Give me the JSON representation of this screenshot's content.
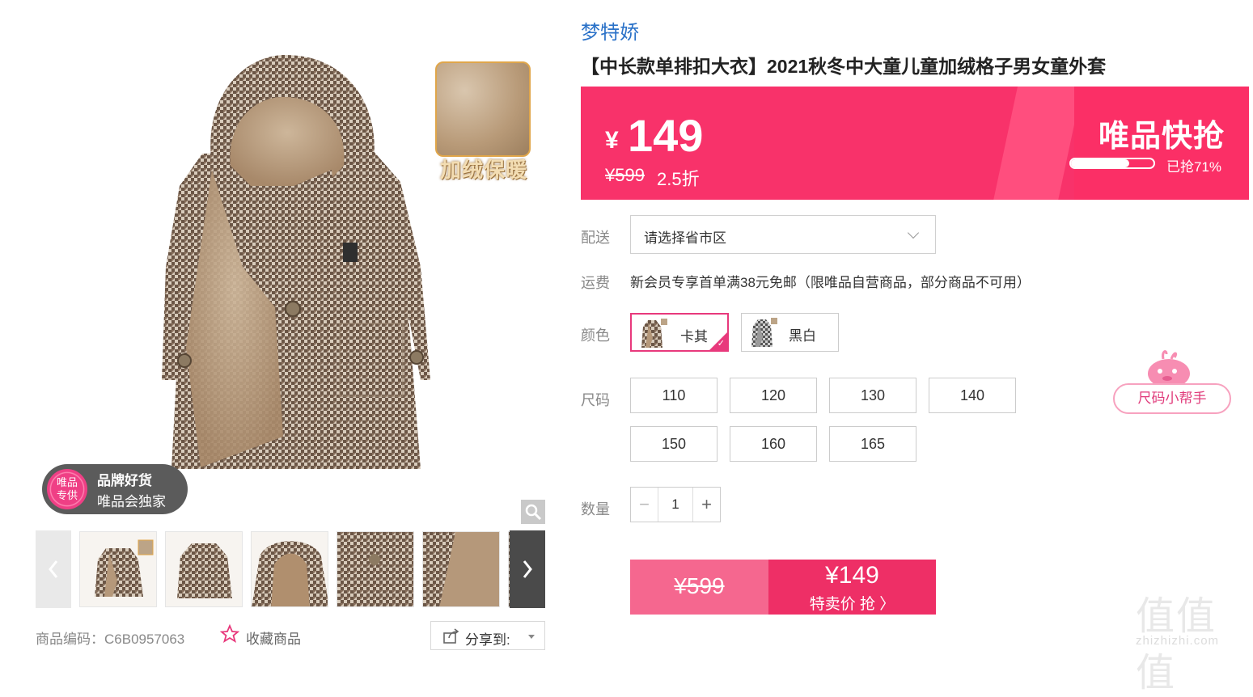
{
  "product": {
    "brand": "梦特娇",
    "title": "【中长款单排扣大衣】2021秋冬中大童儿童加绒格子男女童外套"
  },
  "gallery": {
    "inset_caption": "加绒保暖",
    "badge_seal": "唯品\n专供",
    "badge_title": "品牌好货",
    "badge_subtitle": "唯品会独家",
    "zoom_icon": "magnifier-icon",
    "prev_icon": "chevron-left-icon",
    "next_icon": "chevron-right-icon",
    "thumbnail_count": 6
  },
  "price": {
    "currency": "¥",
    "current": "149",
    "original": "¥599",
    "discount": "2.5折",
    "flash_title": "唯品快抢",
    "sold_text": "已抢71%",
    "sold_fraction": 0.71,
    "banner_color": "#f8326a"
  },
  "delivery": {
    "label": "配送",
    "placeholder": "请选择省市区"
  },
  "shipping": {
    "label": "运费",
    "text": "新会员专享首单满38元免邮（限唯品自营商品，部分商品不可用）"
  },
  "color": {
    "label": "颜色",
    "options": [
      {
        "name": "卡其",
        "selected": true
      },
      {
        "name": "黑白",
        "selected": false
      }
    ],
    "accent": "#e8397c"
  },
  "size": {
    "label": "尺码",
    "options": [
      "110",
      "120",
      "130",
      "140",
      "150",
      "160",
      "165"
    ],
    "helper": "尺码小帮手"
  },
  "quantity": {
    "label": "数量",
    "value": "1",
    "minus": "−",
    "plus": "+"
  },
  "buy": {
    "original": "¥599",
    "price": "¥149",
    "action": "特卖价 抢 〉"
  },
  "footer": {
    "sku_text": "商品编码：C6B0957063",
    "favorite": "收藏商品",
    "share": "分享到:"
  },
  "watermark": {
    "big": "值值值",
    "small": "zhizhizhi.com"
  }
}
